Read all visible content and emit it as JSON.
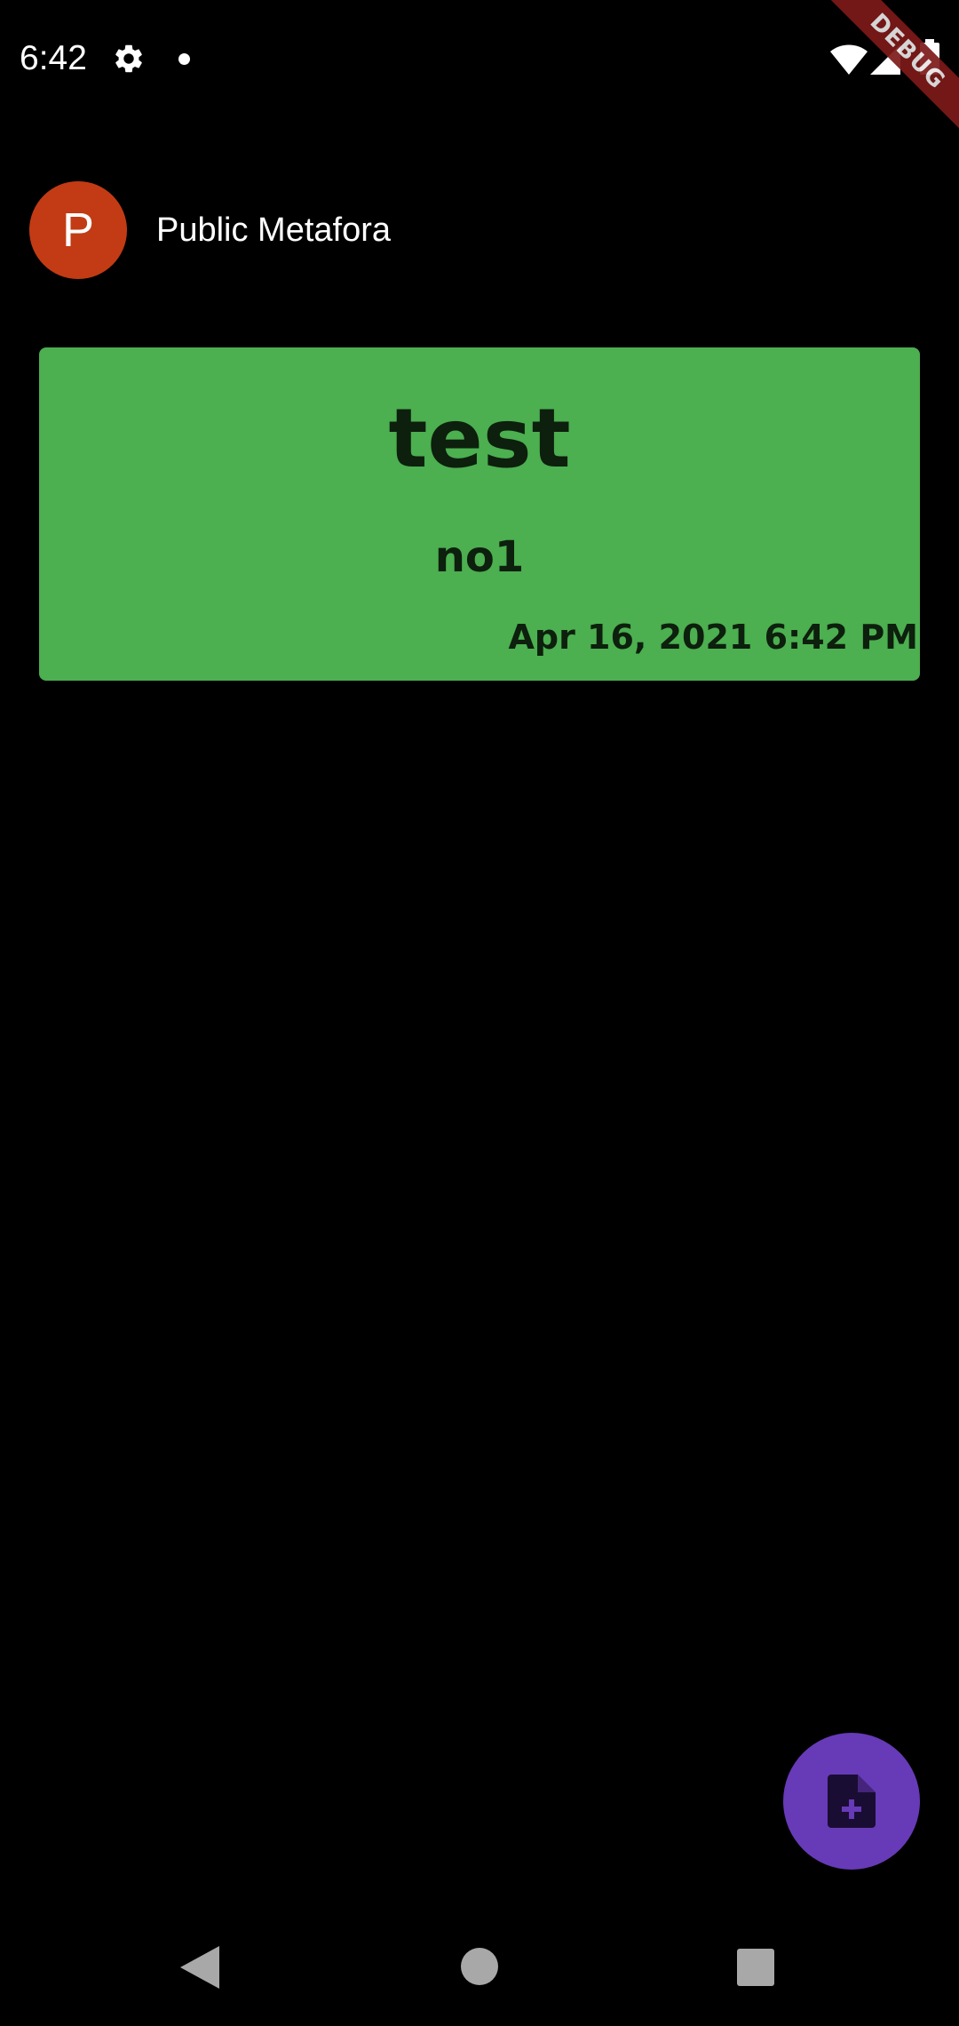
{
  "status_bar": {
    "time": "6:42",
    "icons": [
      "gear-icon",
      "notification-dot-icon",
      "wifi-icon",
      "signal-icon",
      "battery-icon"
    ]
  },
  "debug_banner": {
    "label": "DEBUG",
    "color": "#7d1a1a"
  },
  "header": {
    "avatar_letter": "P",
    "avatar_color": "#c23b14",
    "title": "Public Metafora"
  },
  "notes": [
    {
      "title": "test",
      "body": "no1",
      "date": "Apr 16, 2021 6:42 PM",
      "color": "#4caf50"
    }
  ],
  "fab": {
    "icon": "note-add-icon",
    "color": "#673ab7"
  },
  "nav_bar": {
    "icons": [
      "back-icon",
      "home-icon",
      "recents-icon"
    ]
  }
}
